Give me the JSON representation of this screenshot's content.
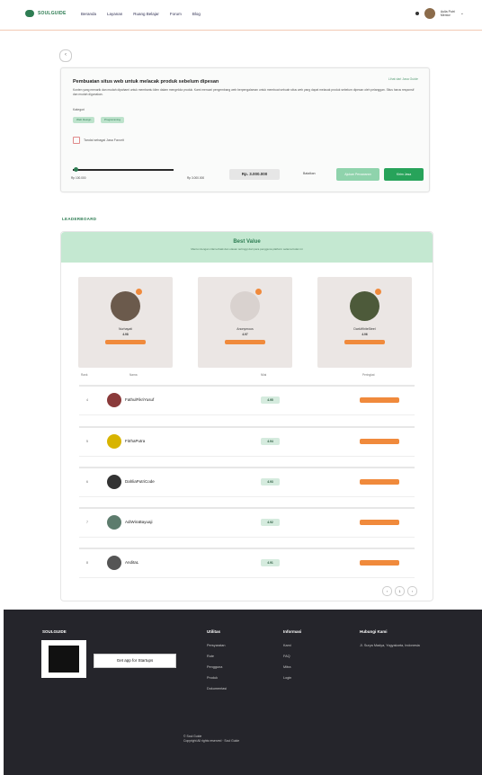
{
  "nav": {
    "brand": "SOULGUIDE",
    "links": [
      "Beranda",
      "Layanan",
      "Ruang Belajar",
      "Forum",
      "Blog"
    ],
    "user_name": "Aulia Putri",
    "user_role": "Mentor"
  },
  "task": {
    "title": "Pembuatan situs web untuk melacak produk sebelum dipesan",
    "link": "Lihat dari Jasa Guide",
    "description": "Konten yang menarik dan mudah dipahami untuk membantu klien dalam mengelola produk. Kami mencari pengembang web berpengalaman untuk membuat sebuah situs web yang dapat melacak produk sebelum dipesan oleh pelanggan. Situs harus responsif dan mudah digunakan.",
    "tags_label": "Kategori",
    "tags": [
      "Web Design",
      "Programming"
    ],
    "checkbox_label": "Tandai sebagai Jasa Favorit",
    "progress_min": "Rp 100.000",
    "progress_max": "Rp 3.000.000",
    "progress_value": 0.02,
    "price": "Rp. 3.000.000",
    "cancel_label": "Batalkan",
    "offer_label": "Ajukan Penawaran",
    "submit_label": "Kirim Jasa"
  },
  "leaderboard": {
    "heading": "LEADERBOARD",
    "banner_title": "Best Value",
    "banner_subtitle": "Mentor dengan nilai terbaik dan ulasan tertinggi dari para pengguna platform selama bulan ini",
    "podium": [
      {
        "name": "Nurhayati",
        "score": "4.98"
      },
      {
        "name": "Anonymous",
        "score": "4.97"
      },
      {
        "name": "DarkWhiteSteel",
        "score": "4.96"
      }
    ],
    "headers": {
      "rank": "Rank",
      "name": "Nama",
      "score": "Nilai",
      "badge": "Peringkat"
    },
    "rows": [
      {
        "rank": "4",
        "name": "FathulFikriYusuf",
        "score": "4.95"
      },
      {
        "name": "FitrhaPutra",
        "rank": "5",
        "score": "4.94"
      },
      {
        "rank": "6",
        "name": "DahliaPutriCode",
        "score": "4.93"
      },
      {
        "rank": "7",
        "name": "AdiWiraBayuaji",
        "score": "4.92"
      },
      {
        "rank": "8",
        "name": "AnditaL",
        "score": "4.91"
      }
    ],
    "pager": [
      "‹",
      "1",
      "›"
    ]
  },
  "footer": {
    "brand": "SOULGUIDE",
    "badge": "Get app for Startups",
    "col1_title": "Utilitas",
    "col1_links": [
      "Persyaratan",
      "Rute",
      "Pengguna",
      "Produk",
      "Dokumentasi"
    ],
    "col2_title": "Informasi",
    "col2_links": [
      "Kami",
      "FAQ",
      "Mitra",
      "Login"
    ],
    "col3_title": "Hubungi Kami",
    "col3_text": "Jl. Surya Madya, Yogyakarta, Indonesia",
    "copy_line1": "© Soul Guide",
    "copy_line2": "Copyright All rights reserved · Soul Guide"
  },
  "colors": {
    "brand_green": "#2e7d53",
    "accent_orange": "#f08a3c",
    "banner_green": "#c4e8d1",
    "footer_bg": "#25252b"
  }
}
